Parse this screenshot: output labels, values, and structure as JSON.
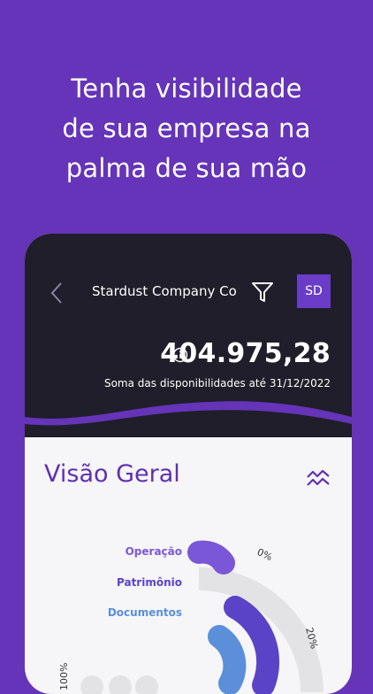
{
  "headline": {
    "line1": "Tenha visibilidade",
    "line2": "de sua empresa na",
    "line3": "palma de sua mão"
  },
  "header": {
    "company": "Stardust Company Co",
    "avatar_initials": "SD"
  },
  "balance": {
    "value": "404.975,28",
    "caption": "Soma das disponibilidades até 31/12/2022"
  },
  "overview": {
    "title": "Visão Geral"
  },
  "chart_data": {
    "type": "radial-bar",
    "series": [
      {
        "name": "Operação",
        "color": "#7a57d6"
      },
      {
        "name": "Patrimônio",
        "color": "#5b43c8"
      },
      {
        "name": "Documentos",
        "color": "#5b8fd9"
      }
    ],
    "tick_labels": [
      "0%",
      "20%",
      "100%"
    ]
  },
  "colors": {
    "background": "#6534b8",
    "header_dark": "#1f1e2a",
    "accent": "#5e31b1",
    "track": "#e3e3e6"
  },
  "icons": [
    "back-icon",
    "filter-icon",
    "info-icon",
    "trend-icon"
  ]
}
